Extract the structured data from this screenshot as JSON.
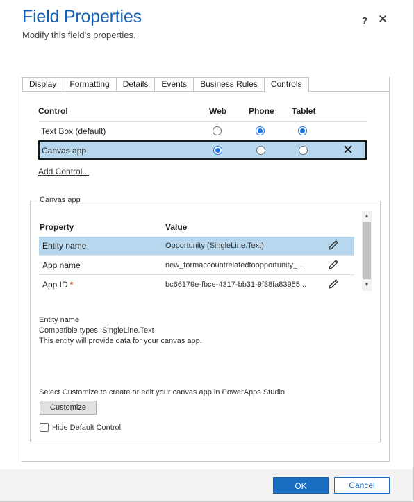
{
  "dialog": {
    "title": "Field Properties",
    "subtitle": "Modify this field's properties.",
    "help_label": "?",
    "close_label": "✕"
  },
  "tabs": [
    {
      "label": "Display",
      "active": false
    },
    {
      "label": "Formatting",
      "active": false
    },
    {
      "label": "Details",
      "active": false
    },
    {
      "label": "Events",
      "active": false
    },
    {
      "label": "Business Rules",
      "active": false
    },
    {
      "label": "Controls",
      "active": true
    }
  ],
  "controls": {
    "headers": {
      "control": "Control",
      "web": "Web",
      "phone": "Phone",
      "tablet": "Tablet"
    },
    "rows": [
      {
        "name": "Text Box (default)",
        "web": false,
        "phone": true,
        "tablet": true,
        "selected": false
      },
      {
        "name": "Canvas app",
        "web": true,
        "phone": false,
        "tablet": false,
        "selected": true,
        "remove_label": "✕"
      }
    ],
    "add_control_label": "Add Control..."
  },
  "canvas_app": {
    "legend": "Canvas app",
    "headers": {
      "property": "Property",
      "value": "Value"
    },
    "rows": [
      {
        "property": "Entity name",
        "value": "Opportunity (SingleLine.Text)",
        "required": false,
        "selected": true
      },
      {
        "property": "App name",
        "value": "new_formaccountrelatedtoopportunity_...",
        "required": false,
        "selected": false
      },
      {
        "property": "App ID",
        "value": "bc66179e-fbce-4317-bb31-9f38fa83955...",
        "required": true,
        "selected": false
      }
    ],
    "required_mark": "*",
    "description": {
      "line1": "Entity name",
      "line2": "Compatible types: SingleLine.Text",
      "line3": "This entity will provide data for your canvas app."
    },
    "customize_hint": "Select Customize to create or edit your canvas app in PowerApps Studio",
    "customize_label": "Customize",
    "hide_default_label": "Hide Default Control",
    "hide_default_checked": false
  },
  "footer": {
    "ok_label": "OK",
    "cancel_label": "Cancel"
  },
  "colors": {
    "accent": "#1a6ec1",
    "title": "#1160b7",
    "selection": "#b7d7ef"
  }
}
